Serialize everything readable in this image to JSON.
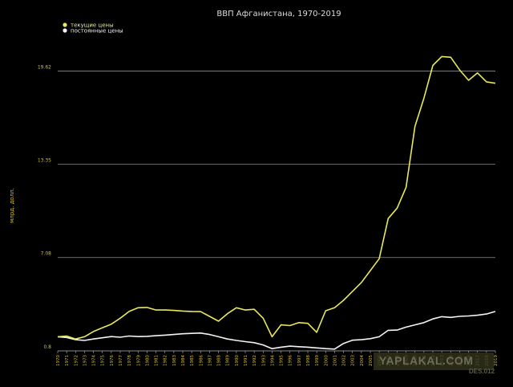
{
  "chart_data": {
    "type": "line",
    "title": "ВВП Афганистана, 1970-2019",
    "xlabel": "",
    "ylabel": "млрд. долл.",
    "ylim": [
      0.8,
      21.0
    ],
    "yticks": [
      0.8,
      7.08,
      13.35,
      19.62
    ],
    "ytick_labels": [
      "0.8",
      "7.08",
      "13.35",
      "19.62"
    ],
    "x": [
      1970,
      1971,
      1972,
      1973,
      1974,
      1975,
      1976,
      1977,
      1978,
      1979,
      1980,
      1981,
      1982,
      1983,
      1984,
      1985,
      1986,
      1987,
      1988,
      1989,
      1990,
      1991,
      1992,
      1993,
      1994,
      1995,
      1996,
      1997,
      1998,
      1999,
      2000,
      2001,
      2002,
      2003,
      2004,
      2005,
      2006,
      2007,
      2008,
      2009,
      2010,
      2011,
      2012,
      2013,
      2014,
      2015,
      2016,
      2017,
      2018,
      2019
    ],
    "x_tick_labels": [
      "1970",
      "1971",
      "1972",
      "1973",
      "1974",
      "1975",
      "1976",
      "1977",
      "1978",
      "1979",
      "1980",
      "1981",
      "1982",
      "1983",
      "1984",
      "1985",
      "1986",
      "1987",
      "1988",
      "1989",
      "1990",
      "1991",
      "1992",
      "1993",
      "1994",
      "1995",
      "1996",
      "1997",
      "1998",
      "1999",
      "2000",
      "2001",
      "2002",
      "2003",
      "2004",
      "2005",
      "2006",
      "2007",
      "2008",
      "2009",
      "2010",
      "2011",
      "2012",
      "2013",
      "2014",
      "2015",
      "2016",
      "2017",
      "2018",
      "2019"
    ],
    "grid": "horizontal",
    "legend_position": "top-left",
    "series": [
      {
        "name": "текущие цены",
        "color": "#e8e85a",
        "values": [
          1.75,
          1.8,
          1.6,
          1.75,
          2.1,
          2.35,
          2.6,
          3.0,
          3.45,
          3.7,
          3.72,
          3.55,
          3.55,
          3.52,
          3.48,
          3.45,
          3.44,
          3.12,
          2.8,
          3.3,
          3.7,
          3.55,
          3.6,
          3.0,
          1.75,
          2.55,
          2.5,
          2.7,
          2.65,
          2.05,
          3.5,
          3.7,
          4.2,
          4.8,
          5.4,
          6.2,
          7.0,
          9.7,
          10.4,
          11.8,
          15.9,
          17.8,
          20.0,
          20.6,
          20.55,
          19.7,
          19.0,
          19.5,
          18.9,
          18.8
        ]
      },
      {
        "name": "постоянные цены",
        "color": "#f4f4f4",
        "values": [
          1.75,
          1.7,
          1.55,
          1.5,
          1.6,
          1.68,
          1.76,
          1.72,
          1.8,
          1.76,
          1.78,
          1.82,
          1.86,
          1.9,
          1.95,
          1.98,
          2.0,
          1.9,
          1.75,
          1.6,
          1.5,
          1.42,
          1.35,
          1.2,
          0.95,
          1.05,
          1.12,
          1.08,
          1.05,
          1.0,
          0.95,
          0.92,
          1.3,
          1.52,
          1.55,
          1.62,
          1.75,
          2.18,
          2.2,
          2.4,
          2.55,
          2.7,
          2.95,
          3.1,
          3.05,
          3.12,
          3.15,
          3.2,
          3.28,
          3.45
        ]
      }
    ]
  },
  "watermark": {
    "main": "YAPLAKAL.COM",
    "sub": "DES.012"
  }
}
